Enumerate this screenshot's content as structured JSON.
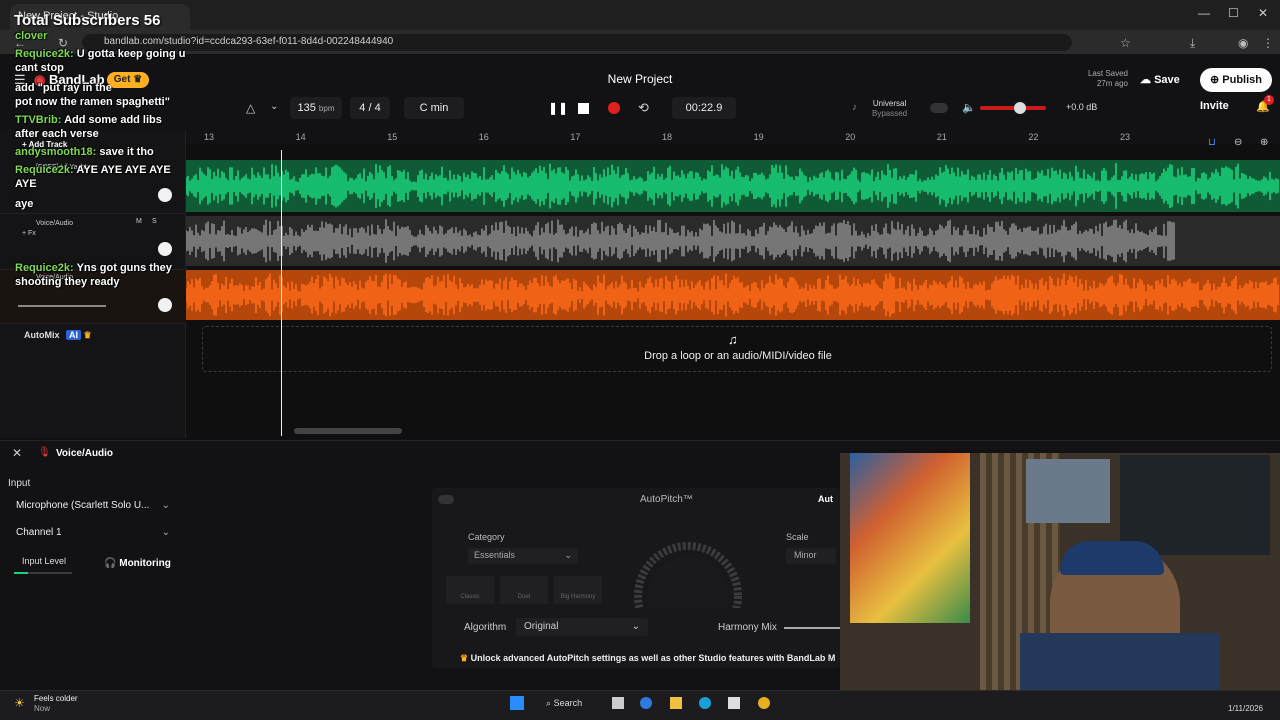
{
  "browser": {
    "tab_title": "New Project - Studio",
    "url": "bandlab.com/studio?id=ccdca293-63ef-f011-8d4d-002248444940"
  },
  "overlay": {
    "subscribers": "Total Subscribers 56",
    "chat": [
      {
        "user": "clover",
        "msg": ""
      },
      {
        "user": "Requice2k:",
        "msg": "U gotta keep going u"
      },
      {
        "user": "",
        "msg": "cant stop"
      },
      {
        "user": "",
        "msg": "add \"put ray in the"
      },
      {
        "user": "",
        "msg": "pot now the ramen spaghetti\""
      },
      {
        "user": "TTVBrib:",
        "msg": "Add some add libs"
      },
      {
        "user": "",
        "msg": "after each verse"
      },
      {
        "user": "andysmooth18:",
        "msg": "save it tho"
      },
      {
        "user": "Requice2k:",
        "msg": "AYE AYE AYE AYE"
      },
      {
        "user": "",
        "msg": "AYE"
      },
      {
        "user": "",
        "msg": "aye"
      },
      {
        "user": "Requice2k:",
        "msg": "Yns got guns they"
      },
      {
        "user": "",
        "msg": "shooting they ready"
      }
    ]
  },
  "header": {
    "brand": "BandLab",
    "get_label": "Get",
    "project_title": "New Project",
    "last_saved_label": "Last Saved",
    "last_saved_time": "27m ago",
    "save_label": "Save",
    "publish_label": "Publish",
    "invite_label": "Invite",
    "notification_count": "1"
  },
  "toolbar": {
    "bpm_value": "135",
    "bpm_unit": "bpm",
    "time_signature": "4 / 4",
    "key": "C min",
    "time": "00:22.9",
    "universal_label": "Universal",
    "universal_state": "Bypassed",
    "volume_db": "+0.0 dB",
    "volume_level": 0.6
  },
  "ruler": {
    "bars": [
      "13",
      "14",
      "15",
      "16",
      "17",
      "18",
      "19",
      "20",
      "21",
      "22",
      "23"
    ]
  },
  "tracks": {
    "add_track_label": "Add Track",
    "items": [
      {
        "name": "[FREE] Lil Yachty x",
        "color": "#19d47c"
      },
      {
        "name": "Voice/Audio",
        "color": "#8a8a8a"
      },
      {
        "name": "Voice/Audio",
        "color": "#ff6a1a"
      }
    ],
    "mute_label": "M",
    "solo_label": "S",
    "fx_label": "+ Fx",
    "automix_label": "AutoMix",
    "ai_label": "AI",
    "drop_text": "Drop a loop or an audio/MIDI/video file"
  },
  "bottom_panel": {
    "title": "Voice/Audio",
    "input_label": "Input",
    "microphone": "Microphone (Scarlett Solo U...",
    "channel": "Channel 1",
    "input_level_label": "Input Level",
    "monitoring_label": "Monitoring",
    "autopitch": {
      "title": "AutoPitch™",
      "category_label": "Category",
      "category_value": "Essentials",
      "scale_label": "Scale",
      "scale_value": "Minor",
      "algorithm_label": "Algorithm",
      "algorithm_value": "Original",
      "harmony_mix_label": "Harmony Mix",
      "effects": [
        "Classic",
        "Duet",
        "Big Harmony"
      ],
      "unlock_text": "Unlock advanced AutoPitch settings as well as other Studio features with BandLab M",
      "auto_label": "Aut"
    }
  },
  "taskbar": {
    "weather_title": "Feels colder",
    "weather_sub": "Now",
    "search_label": "Search",
    "date": "1/11/2026"
  },
  "colors": {
    "green_track": "#19d47c",
    "orange_track": "#ff6a1a",
    "record_red": "#e02020",
    "brand_red": "#f03a3a"
  }
}
